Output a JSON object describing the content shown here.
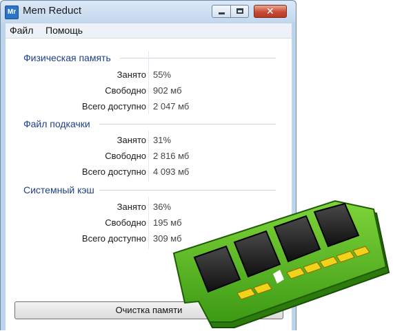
{
  "window": {
    "title": "Mem Reduct",
    "icon_text": "Mr",
    "close_glyph": "✕"
  },
  "menu": {
    "file": "Файл",
    "help": "Помощь"
  },
  "sections": [
    {
      "title": "Физическая память",
      "rows": [
        {
          "label": "Занято",
          "value": "55%"
        },
        {
          "label": "Свободно",
          "value": "902 мб"
        },
        {
          "label": "Всего доступно",
          "value": "2 047 мб"
        }
      ]
    },
    {
      "title": "Файл подкачки",
      "rows": [
        {
          "label": "Занято",
          "value": "31%"
        },
        {
          "label": "Свободно",
          "value": "2 816 мб"
        },
        {
          "label": "Всего доступно",
          "value": "4 093 мб"
        }
      ]
    },
    {
      "title": "Системный кэш",
      "rows": [
        {
          "label": "Занято",
          "value": "36%"
        },
        {
          "label": "Свободно",
          "value": "195 мб"
        },
        {
          "label": "Всего доступно",
          "value": "309 мб"
        }
      ]
    }
  ],
  "footer": {
    "clean_button": "Очистка памяти"
  },
  "colors": {
    "section_header": "#1e3f8a",
    "ram_board": "#4caf1e",
    "ram_chip": "#1e1e1e",
    "ram_contact": "#f2d21a"
  },
  "icons": [
    "app-icon",
    "minimize-icon",
    "maximize-icon",
    "close-icon",
    "ram-module-icon"
  ]
}
